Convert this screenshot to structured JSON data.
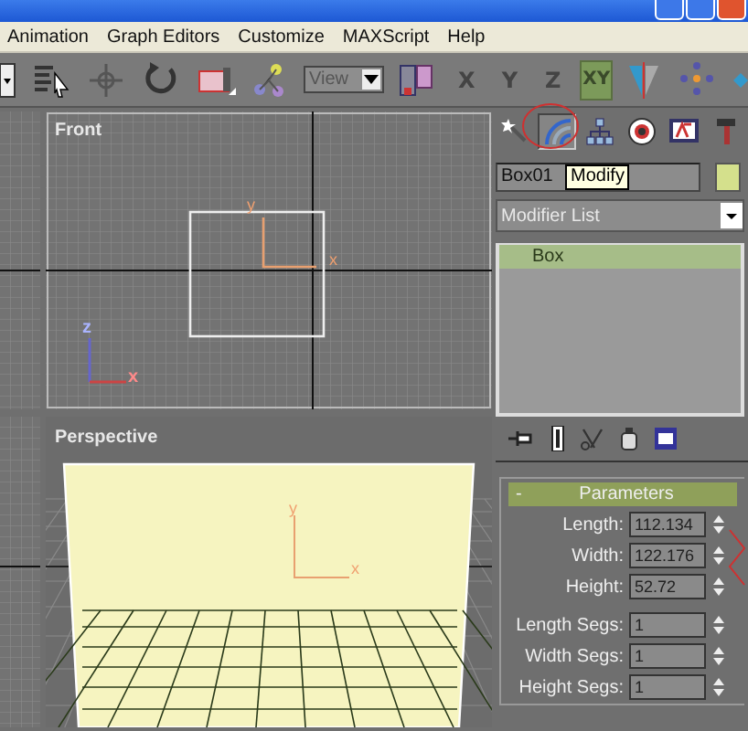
{
  "menu": [
    {
      "label": "Animation"
    },
    {
      "label": "Graph Editors"
    },
    {
      "label": "Customize"
    },
    {
      "label": "MAXScript"
    },
    {
      "label": "Help"
    }
  ],
  "toolbar": {
    "reference": "View",
    "axis_buttons": [
      {
        "label": "X",
        "selected": false
      },
      {
        "label": "Y",
        "selected": false
      },
      {
        "label": "Z",
        "selected": false
      },
      {
        "label": "XY",
        "selected": true
      }
    ]
  },
  "viewports": {
    "front": {
      "label": "Front",
      "gizmo_labels": [
        "y",
        "x"
      ],
      "tripod_labels": [
        "z",
        "x"
      ]
    },
    "perspective": {
      "label": "Perspective",
      "gizmo_labels": [
        "y",
        "x"
      ]
    }
  },
  "command_panel": {
    "tabs": [
      {
        "kind": "create",
        "selected": false
      },
      {
        "kind": "modify",
        "selected": true
      },
      {
        "kind": "hierarchy",
        "selected": false
      },
      {
        "kind": "motion",
        "selected": false
      },
      {
        "kind": "display",
        "selected": false
      },
      {
        "kind": "utilities",
        "selected": false
      }
    ],
    "object": {
      "name": "Box01",
      "color": "#d4e08c"
    },
    "tooltip": "Modify",
    "modifier_list": "Modifier List",
    "stack": [
      {
        "label": "Box",
        "selected": true
      }
    ],
    "rollout": {
      "collapse": "-",
      "title": "Parameters",
      "fields": [
        {
          "label": "Length:",
          "value": "112.134"
        },
        {
          "label": "Width:",
          "value": "122.176"
        },
        {
          "label": "Height:",
          "value": "52.72"
        },
        {
          "label": "Length Segs:",
          "value": "1"
        },
        {
          "label": "Width Segs:",
          "value": "1"
        },
        {
          "label": "Height Segs:",
          "value": "1"
        }
      ]
    }
  }
}
